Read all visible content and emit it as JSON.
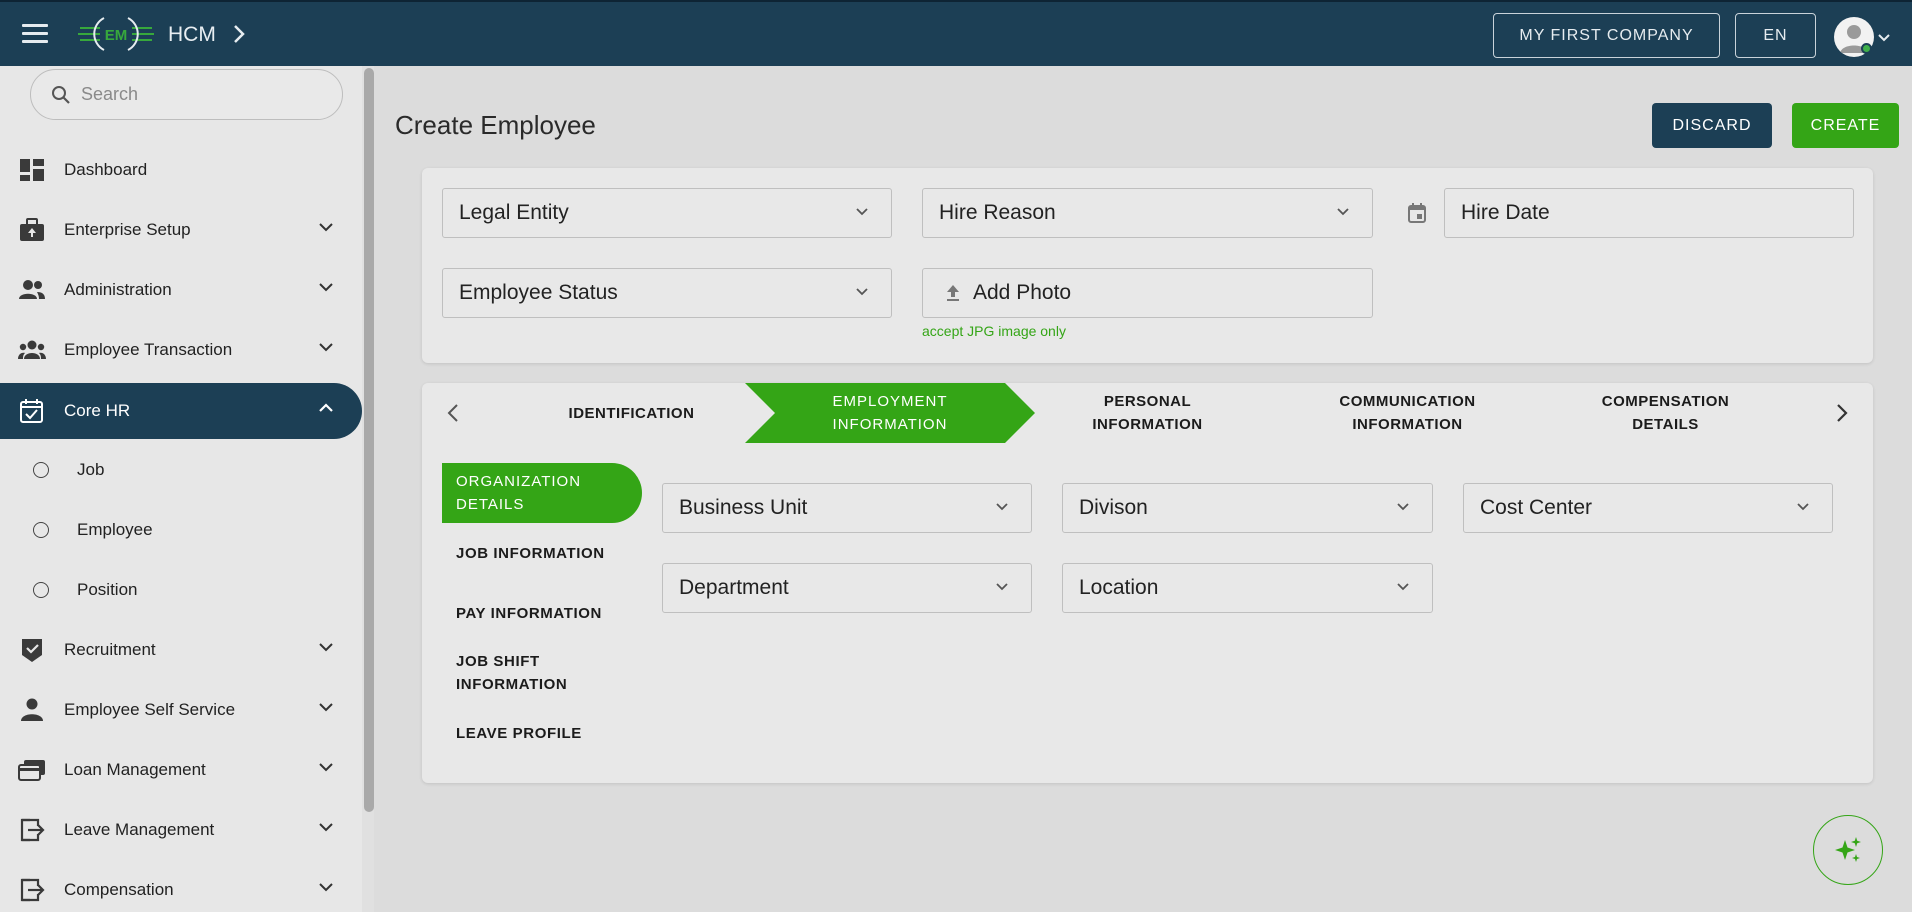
{
  "header": {
    "app_name": "HCM",
    "logo_text": "EM",
    "company_button": "MY FIRST COMPANY",
    "language_button": "EN"
  },
  "sidebar": {
    "search_placeholder": "Search",
    "items": [
      {
        "label": "Dashboard"
      },
      {
        "label": "Enterprise Setup"
      },
      {
        "label": "Administration"
      },
      {
        "label": "Employee Transaction"
      },
      {
        "label": "Core HR"
      },
      {
        "label": "Recruitment"
      },
      {
        "label": "Employee Self Service"
      },
      {
        "label": "Loan Management"
      },
      {
        "label": "Leave Management"
      },
      {
        "label": "Compensation"
      }
    ],
    "core_hr_sub": [
      {
        "label": "Job"
      },
      {
        "label": "Employee"
      },
      {
        "label": "Position"
      }
    ]
  },
  "main": {
    "title": "Create Employee",
    "discard_label": "DISCARD",
    "create_label": "CREATE",
    "top_fields": {
      "legal_entity": "Legal Entity",
      "hire_reason": "Hire Reason",
      "hire_date": "Hire Date",
      "employee_status": "Employee Status",
      "add_photo": "Add Photo",
      "photo_helper": "accept JPG image only"
    },
    "steps": [
      {
        "line1": "IDENTIFICATION",
        "line2": ""
      },
      {
        "line1": "EMPLOYMENT",
        "line2": "INFORMATION"
      },
      {
        "line1": "PERSONAL",
        "line2": "INFORMATION"
      },
      {
        "line1": "COMMUNICATION",
        "line2": "INFORMATION"
      },
      {
        "line1": "COMPENSATION",
        "line2": "DETAILS"
      }
    ],
    "sub_tabs": [
      {
        "line1": "ORGANIZATION",
        "line2": "DETAILS"
      },
      {
        "line1": "JOB INFORMATION",
        "line2": ""
      },
      {
        "line1": "PAY INFORMATION",
        "line2": ""
      },
      {
        "line1": "JOB SHIFT",
        "line2": "INFORMATION"
      },
      {
        "line1": "LEAVE PROFILE",
        "line2": ""
      }
    ],
    "org_fields": {
      "business_unit": "Business Unit",
      "division": "Divison",
      "cost_center": "Cost Center",
      "department": "Department",
      "location": "Location"
    }
  },
  "colors": {
    "navy": "#1c3f55",
    "green": "#34a516",
    "background": "#dcdcdc"
  }
}
